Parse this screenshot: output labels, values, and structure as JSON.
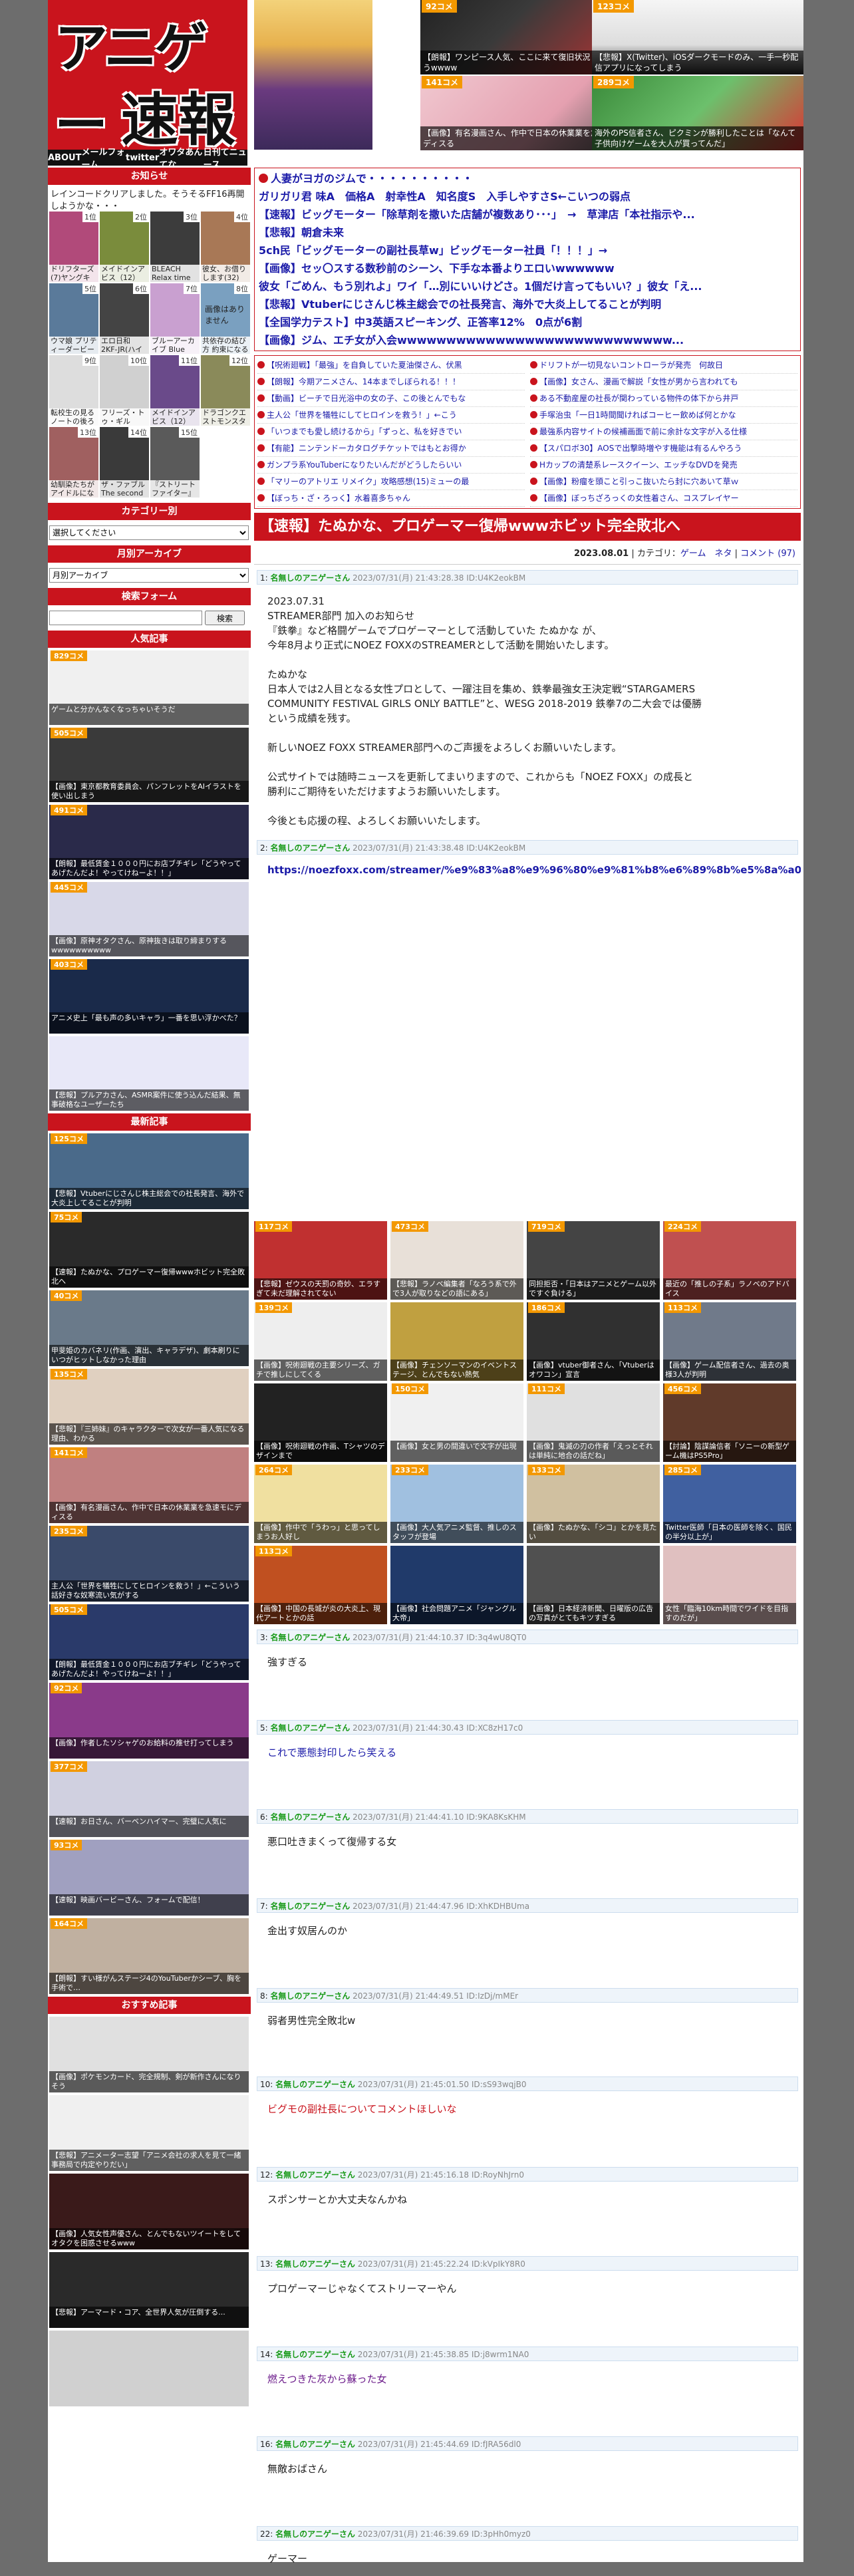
{
  "header": {
    "logo_line1": "アニゲー",
    "logo_line2": "速報",
    "nav": [
      "ABOUT",
      "メールフォーム",
      "twitter",
      "オワタあんてな",
      "日刊てニュース"
    ],
    "thumbs": [
      {
        "count": "92コメ",
        "caption": "【朗報】ワンピース人気、ここに来て復旧状況してしまうwwww"
      },
      {
        "count": "123コメ",
        "caption": "【悲報】X(Twitter)、iOSダークモードのみ、一手一秒配信アプリになってしまう"
      },
      {
        "count": "141コメ",
        "caption": "【画像】有名漫画さん、作中で日本の休業業を急速モにディスる"
      },
      {
        "count": "289コメ",
        "caption": "海外のPS信者さん、ピクミンが勝利したことは「なんて子供向けゲームを大人が買ってんだ」"
      }
    ]
  },
  "sidebar": {
    "notice_title": "お知らせ",
    "notice_text": "レインコードクリアしました。そうそるFF16再開しようかな・・・",
    "rank_items": [
      {
        "n": "1位",
        "t": "ドリフターズ(7)ヤングキング"
      },
      {
        "n": "2位",
        "t": "メイドインアビス（12）(バンブー"
      },
      {
        "n": "3位",
        "t": "BLEACH Relax time 百鬼夜行"
      },
      {
        "n": "",
        "t": ""
      },
      {
        "n": "4位",
        "t": "彼女、お借りします(32)"
      },
      {
        "n": "5位",
        "t": "ウマ娘 プリティーダービー"
      },
      {
        "n": "6位",
        "t": "エロ日和 2KF-JR(ハイブリッドビーコミックス)"
      },
      {
        "n": "",
        "t": ""
      },
      {
        "n": "7位",
        "t": "ブルーアーカイブ Blue"
      },
      {
        "n": "8位",
        "t": "共依存の結び方 約束になる"
      },
      {
        "n": "9位",
        "t": "転校生の見る ノートの後ろ"
      },
      {
        "n": "",
        "t": ""
      },
      {
        "n": "10位",
        "t": "フリーズ・トゥ・ギル"
      },
      {
        "n": "11位",
        "t": "メイドインアビス（12）"
      },
      {
        "n": "12位",
        "t": "ドラゴンクエストモンスターズ"
      },
      {
        "n": "",
        "t": ""
      },
      {
        "n": "13位",
        "t": "幼馴染たちがアイドルになる"
      },
      {
        "n": "14位",
        "t": "ザ・ファブル The second"
      },
      {
        "n": "15位",
        "t": "『ストリートファイター』"
      },
      {
        "n": "",
        "t": ""
      }
    ],
    "noimage": "画像はありません",
    "category_title": "カテゴリー別",
    "category_select": "選択してください",
    "archive_title": "月別アーカイブ",
    "archive_select": "月別アーカイブ",
    "search_title": "検索フォーム",
    "search_button": "検索",
    "popular_title": "人気記事",
    "popular": [
      {
        "count": "829コメ",
        "caption": "ゲームと分かんなくなっちゃいそうだ"
      },
      {
        "count": "505コメ",
        "caption": "【画像】東京都教育委員会、パンフレットをAIイラストを使い出しまう"
      },
      {
        "count": "491コメ",
        "caption": "【朗報】最低賃金１０００円にお店ブチギレ「どうやってあげたんだよ！やってけねーよ！！」"
      },
      {
        "count": "445コメ",
        "caption": "【画像】原神オタクさん、原神抜きは取り締まりするwwwwwwwwww"
      },
      {
        "count": "403コメ",
        "caption": "アニメ史上「最も声の多いキャラ」一番を思い浮かべた？"
      },
      {
        "count": "",
        "caption": "【悲報】プルアカさん、ASMR案件に使う込んだ結果、無事破格なユーザーたち"
      }
    ],
    "latest_title": "最新記事",
    "latest": [
      {
        "count": "125コメ",
        "caption": "【悲報】Vtuberにじさんじ株主総会での社長発言、海外で大炎上してることが判明"
      },
      {
        "count": "75コメ",
        "caption": "【速報】たぬかな、プロゲーマー復帰wwwホビット完全敗北へ"
      },
      {
        "count": "40コメ",
        "caption": "甲斐姫のカバネリ(作画、演出、キャラデザ)、劇本刷りにいつがヒットしなかった理由"
      },
      {
        "count": "135コメ",
        "caption": "【悲報】『三姉妹』のキャラクターで次女が一番人気になる理由、わかる"
      },
      {
        "count": "141コメ",
        "caption": "【画像】有名漫画さん、作中で日本の休業業を急速モにディスる"
      },
      {
        "count": "235コメ",
        "caption": "主人公「世界を犠牲にしてヒロインを救う！」←こういう話好きな奴寒流い気がする"
      },
      {
        "count": "505コメ",
        "caption": "【朗報】最低賃金１０００円にお店ブチギレ「どうやってあげたんだよ！やってけねーよ！！」"
      },
      {
        "count": "92コメ",
        "caption": "【画像】作者したソシャゲのお給料の推せ打ってしまう"
      },
      {
        "count": "377コメ",
        "caption": "【速報】お日さん、バーベンハイマー、完璧に人気に"
      },
      {
        "count": "93コメ",
        "caption": "【速報】映画バービーさん、フォームで配信！"
      },
      {
        "count": "164コメ",
        "caption": "【朗報】すい様がんステージ4のYouTuberかシーブ、胸を手術で…"
      }
    ],
    "recommend_title": "おすすめ記事",
    "recommend": [
      {
        "count": "",
        "caption": "【画像】ポケモンカード、完全規制、剣が新作さんになりそう"
      },
      {
        "count": "",
        "caption": "【悲報】アニメーター志望「アニメ会社の求人を見て一緒事務局で内定やりだい」"
      },
      {
        "count": "",
        "caption": "【画像】人気女性声優さん、とんでもないツイートをしてオタクを困惑させるwww"
      },
      {
        "count": "",
        "caption": "【悲報】アーマード・コア、全世界人気が圧倒する..."
      },
      {
        "count": "",
        "caption": ""
      }
    ]
  },
  "main": {
    "top_links": [
      "人妻がヨガのジムで・・・・・・・・・・",
      "ガリガリ君 味A　価格A　射幸性A　知名度S　入手しやすさS←こいつの弱点",
      "【速報】ビッグモーター「除草剤を撒いた店舗が複数あり･･･」　→　草津店「本社指示や...",
      "【悲報】朝倉未来",
      "5ch民「ビッグモーターの副社長草w」ビッグモーター社員「！！！」→",
      "【画像】セッ〇スする数秒前のシーン、下手な本番よりエロいwwwwww",
      "彼女「ごめん、もう別れよ」ワイ「…別にいいけどさ。1個だけ言ってもいい？」彼女「え...",
      "【悲報】Vtuberにじさんじ株主総会での社長発言、海外で大炎上してることが判明",
      "【全国学力テスト】中3英語スピーキング、正答率12%　0点が6割",
      "【画像】ジム、エチ女が入会wwwwwwwwwwwwwwwwwwwwwwwwwwww..."
    ],
    "two_col": [
      "【呪術廻戦】「最強」を自負していた夏油傑さん、伏黒",
      "ドリフトが一切見ないコントローラが発売　何故日",
      "【朗報】今期アニメさん、14本までしぼられる！！！",
      "【画像】女さん、漫画で解説「女性が男から言われても",
      "【動画】ビーチで日光浴中の女の子、この後とんでもな",
      "ある不動産屋の社長が関わっている物件の体下から井戸",
      "主人公「世界を犠牲にしてヒロインを救う！」←こう",
      "手塚治虫「一日1時間聞ければコーヒー飲めば何とかな",
      "「いつまでも愛し続けるから」「ずっと、私を好きでい",
      "最強系内容サイトの候補画面で前に余計な文字が入る仕様",
      "【有能】ニンテンドーカタログチケットではもとお得か",
      "【スパロボ30】AOSで出撃時増やす機能は有るんやろう",
      "ガンプラ系YouTuberになりたいんだがどうしたらいい",
      "Hカップの清楚系レースクイーン、エッチなDVDを発売",
      "「マリーのアトリエ リメイク」攻略感想(15)ミューの最",
      "【画像】粉瘤を頭こと引っこ抜いたら封に穴あいて草ｗ",
      "【ぼっち・ざ・ろっく】水着喜多ちゃん",
      "【画像】ぼっちざろっくの女性着さん、コスプレイヤー"
    ],
    "article": {
      "title": "【速報】たぬかな、プロゲーマー復帰wwwホビット完全敗北へ",
      "date": "2023.08.01",
      "category_label": "カテゴリ：",
      "categories": "ゲーム　ネタ",
      "comments": "コメント (97)",
      "post1_no": "1:",
      "post1_name": "名無しのアニゲーさん",
      "post1_date": "2023/07/31(月) 21:43:28.38 ID:U4K2eokBM",
      "post1_lines": [
        "2023.07.31",
        "STREAMER部門 加入のお知らせ",
        "『鉄拳』など格闘ゲームでプロゲーマーとして活動していた たぬかな が、",
        "今年8月より正式にNOEZ FOXXのSTREAMERとして活動を開始いたします。",
        "",
        "たぬかな",
        "日本人では2人目となる女性プロとして、一躍注目を集め、鉄拳最強女王決定戦“STARGAMERS",
        "COMMUNITY FESTIVAL GIRLS ONLY BATTLE”と、WESG 2018-2019 鉄拳7の二大会では優勝",
        "という成績を残す。",
        "",
        "新しいNOEZ FOXX STREAMER部門へのご声援をよろしくお願いいたします。",
        "",
        "公式サイトでは随時ニュースを更新してまいりますので、これからも「NOEZ FOXX」の成長と",
        "勝利にご期待をいただけますようお願いいたします。",
        "",
        "今後とも応援の程、よろしくお願いいたします。"
      ],
      "post2_no": "2:",
      "post2_name": "名無しのアニゲーさん",
      "post2_date": "2023/07/31(月) 21:43:38.48 ID:U4K2eokBM",
      "post2_url": "https://noezfoxx.com/streamer/%e9%83%a8%e9%96%80%e9%81%b8%e6%89%8b%e5%8a%a0%e5%85%a5"
    },
    "grid": [
      {
        "count": "117コメ",
        "caption": "【悲報】ゼウスの天罰の奇妙、エラすぎて未だ理解されてない"
      },
      {
        "count": "473コメ",
        "caption": "【悲報】ラノベ編集者「なろう系で外で3人が取りなどの語にある」"
      },
      {
        "count": "719コメ",
        "caption": "同担拒否・「日本はアニメとゲーム以外ですぐ負ける」"
      },
      {
        "count": "224コメ",
        "caption": "最近の「推しの子系」ラノベのアドバイス"
      },
      {
        "count": "139コメ",
        "caption": "【画像】呪術廻戦の主要シリーズ、ガチで推しにしてくる"
      },
      {
        "count": "",
        "caption": "【画像】チェンソーマンのイベントステージ、とんでもない熱気"
      },
      {
        "count": "186コメ",
        "caption": "【画像】vtuber御者さん、「Vtuberはオワコン」宣言"
      },
      {
        "count": "113コメ",
        "caption": "【画像】ゲーム配信者さん、過去の奥様3人が判明"
      },
      {
        "count": "",
        "caption": "【画像】呪術廻戦の作画、Tシャツのデザインまで"
      },
      {
        "count": "150コメ",
        "caption": "【画像】女と男の間違いで文字が出現"
      },
      {
        "count": "111コメ",
        "caption": "【画像】鬼滅の刃の作者「えっとそれは単純に地合の話だね」"
      },
      {
        "count": "456コメ",
        "caption": "【討論】陰謀論信者「ソニーの新型ゲーム機はPS5Pro」"
      },
      {
        "count": "264コメ",
        "caption": "【画像】作中で「うわっ」と思ってしまうお人好し"
      },
      {
        "count": "233コメ",
        "caption": "【画像】大人気アニメ監督、推しのスタッフが登場"
      },
      {
        "count": "133コメ",
        "caption": "【画像】たぬかな、「シコ」とかを見たい"
      },
      {
        "count": "285コメ",
        "caption": "Twitter医師「日本の医師を除く、国民の半分以上が」"
      },
      {
        "count": "113コメ",
        "caption": "【画像】中国の長城が炎の大炎上、現代アートとかの話"
      },
      {
        "count": "",
        "caption": "【画像】社会問題アニメ「ジャングル大帝」"
      },
      {
        "count": "",
        "caption": "【画像】日本経済新聞、日曜版の広告の写真がとてもキツすぎる"
      },
      {
        "count": "",
        "caption": "女性「臨海10km時間でワイドを目指すのだが」"
      }
    ],
    "comments": [
      {
        "no": "3:",
        "name": "名無しのアニゲーさん",
        "date": "2023/07/31(月) 21:44:10.37 ID:3q4wU8QT0",
        "text": "強すぎる",
        "style": "plain"
      },
      {
        "no": "5:",
        "name": "名無しのアニゲーさん",
        "date": "2023/07/31(月) 21:44:30.43 ID:XC8zH17c0",
        "text": "これで悪態封印したら笑える",
        "style": "blue"
      },
      {
        "no": "6:",
        "name": "名無しのアニゲーさん",
        "date": "2023/07/31(月) 21:44:41.10 ID:9KA8KsKHM",
        "text": "悪口吐きまくって復帰する女",
        "style": "plain"
      },
      {
        "no": "7:",
        "name": "名無しのアニゲーさん",
        "date": "2023/07/31(月) 21:44:47.96 ID:XhKDHBUma",
        "text": "金出す奴居んのか",
        "style": "plain"
      },
      {
        "no": "8:",
        "name": "名無しのアニゲーさん",
        "date": "2023/07/31(月) 21:44:49.51 ID:IzDj/mMEr",
        "text": "弱者男性完全敗北w",
        "style": "plain"
      },
      {
        "no": "10:",
        "name": "名無しのアニゲーさん",
        "date": "2023/07/31(月) 21:45:01.50 ID:sS93wqjB0",
        "text": "ビグモの副社長についてコメントほしいな",
        "style": "red"
      },
      {
        "no": "12:",
        "name": "名無しのアニゲーさん",
        "date": "2023/07/31(月) 21:45:16.18 ID:RoyNhJrn0",
        "text": "スポンサーとか大丈夫なんかね",
        "style": "plain"
      },
      {
        "no": "13:",
        "name": "名無しのアニゲーさん",
        "date": "2023/07/31(月) 21:45:22.24 ID:kVpIkY8R0",
        "text": "プロゲーマーじゃなくてストリーマーやん",
        "style": "plain"
      },
      {
        "no": "14:",
        "name": "名無しのアニゲーさん",
        "date": "2023/07/31(月) 21:45:38.85 ID:j8wrm1NA0",
        "text": "燃えつきた灰から蘇った女",
        "style": "pur"
      },
      {
        "no": "16:",
        "name": "名無しのアニゲーさん",
        "date": "2023/07/31(月) 21:45:44.69 ID:fJRA56dl0",
        "text": "無敵おばさん",
        "style": "plain"
      },
      {
        "no": "22:",
        "name": "名無しのアニゲーさん",
        "date": "2023/07/31(月) 21:46:39.69 ID:3pHh0myz0",
        "text": "ゲーマー",
        "style": "plain"
      }
    ]
  }
}
